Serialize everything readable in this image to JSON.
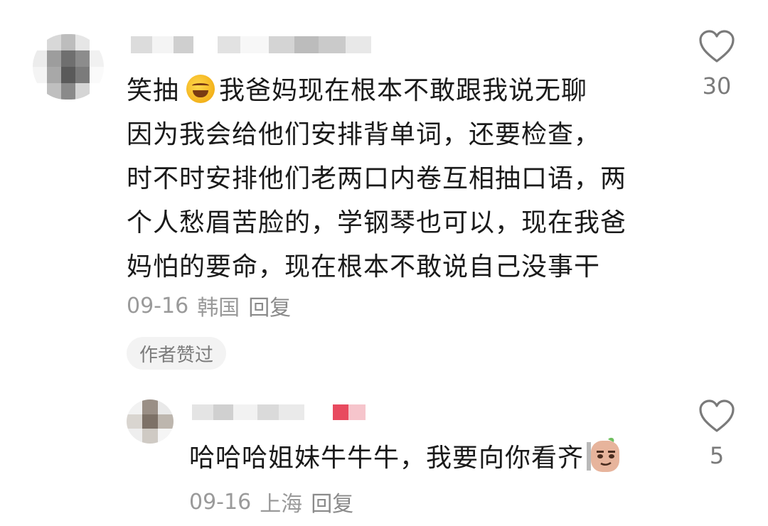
{
  "comments": [
    {
      "text_lines": [
        "笑抽",
        "我爸妈现在根本不敢跟我说无聊",
        "因为我会给他们安排背单词，还要检查，",
        "时不时安排他们老两口内卷互相抽口语，两",
        "个人愁眉苦脸的，学钢琴也可以，现在我爸",
        "妈怕的要命，现在根本不敢说自己没事干"
      ],
      "emoji": "rolling-on-floor-laughing",
      "date": "09-16",
      "location": "韩国",
      "reply_label": "回复",
      "badge": "作者赞过",
      "like_count": "30"
    },
    {
      "text": "哈哈哈姐妹牛牛牛，我要向你看齐",
      "sticker": "smirking-sticker",
      "date": "09-16",
      "location": "上海",
      "reply_label": "回复",
      "like_count": "5"
    }
  ],
  "colors": {
    "text": "#1a1a1a",
    "meta": "#9a9a9a",
    "icon": "#7a7a7a",
    "badge_bg": "#f3f3f3",
    "accent_blur": "#e84a5f"
  },
  "icons": {
    "like": "heart-outline-icon"
  }
}
